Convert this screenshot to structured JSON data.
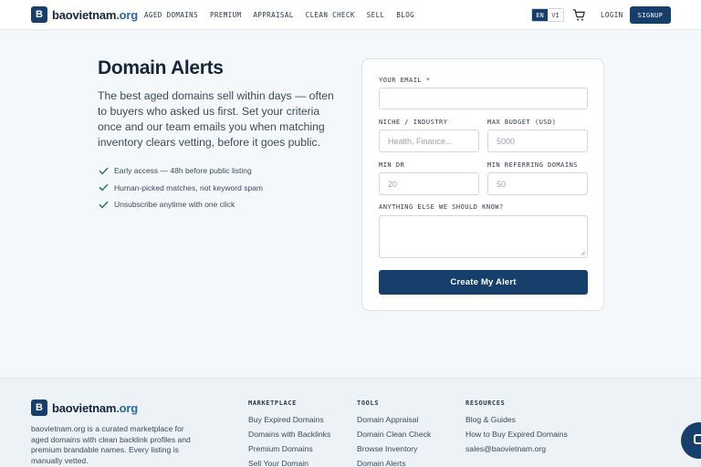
{
  "header": {
    "logo_letter": "B",
    "logo_name": "baovietnam",
    "logo_tld": ".org",
    "nav": [
      "AGED DOMAINS",
      "PREMIUM",
      "APPRAISAL",
      "CLEAN CHECK",
      "SELL",
      "BLOG"
    ],
    "lang_en": "EN",
    "lang_vi": "VI",
    "login": "LOGIN",
    "signup": "SIGNUP"
  },
  "hero": {
    "title": "Domain Alerts",
    "description": "The best aged domains sell within days — often to buyers who asked us first. Set your criteria once and our team emails you when matching inventory clears vetting, before it goes public.",
    "benefits": [
      "Early access — 48h before public listing",
      "Human-picked matches, not keyword spam",
      "Unsubscribe anytime with one click"
    ]
  },
  "form": {
    "email_label": "YOUR EMAIL *",
    "email_value": "",
    "niche_label": "NICHE / INDUSTRY",
    "niche_placeholder": "Health, Finance...",
    "budget_label": "MAX BUDGET (USD)",
    "budget_placeholder": "5000",
    "dr_label": "MIN DR",
    "dr_placeholder": "20",
    "rd_label": "MIN REFERRING DOMAINS",
    "rd_placeholder": "50",
    "notes_label": "ANYTHING ELSE WE SHOULD KNOW?",
    "notes_value": "",
    "submit_label": "Create My Alert"
  },
  "footer": {
    "description": "baovietnam.org is a curated marketplace for aged domains with clean backlink profiles and premium brandable names. Every listing is manually vetted.",
    "columns": [
      {
        "title": "MARKETPLACE",
        "links": [
          "Buy Expired Domains",
          "Domains with Backlinks",
          "Premium Domains",
          "Sell Your Domain"
        ]
      },
      {
        "title": "TOOLS",
        "links": [
          "Domain Appraisal",
          "Domain Clean Check",
          "Browse Inventory",
          "Domain Alerts"
        ]
      },
      {
        "title": "RESOURCES",
        "links": [
          "Blog & Guides",
          "How to Buy Expired Domains",
          "sales@baovietnam.org"
        ]
      }
    ]
  },
  "icons": {
    "cart": "cart-icon",
    "check": "check-icon",
    "chat": "chat-icon"
  },
  "colors": {
    "brand": "#163f6b",
    "accent_tld": "#2a67a8",
    "check": "#2a7a52",
    "background": "#f5f8fb"
  }
}
